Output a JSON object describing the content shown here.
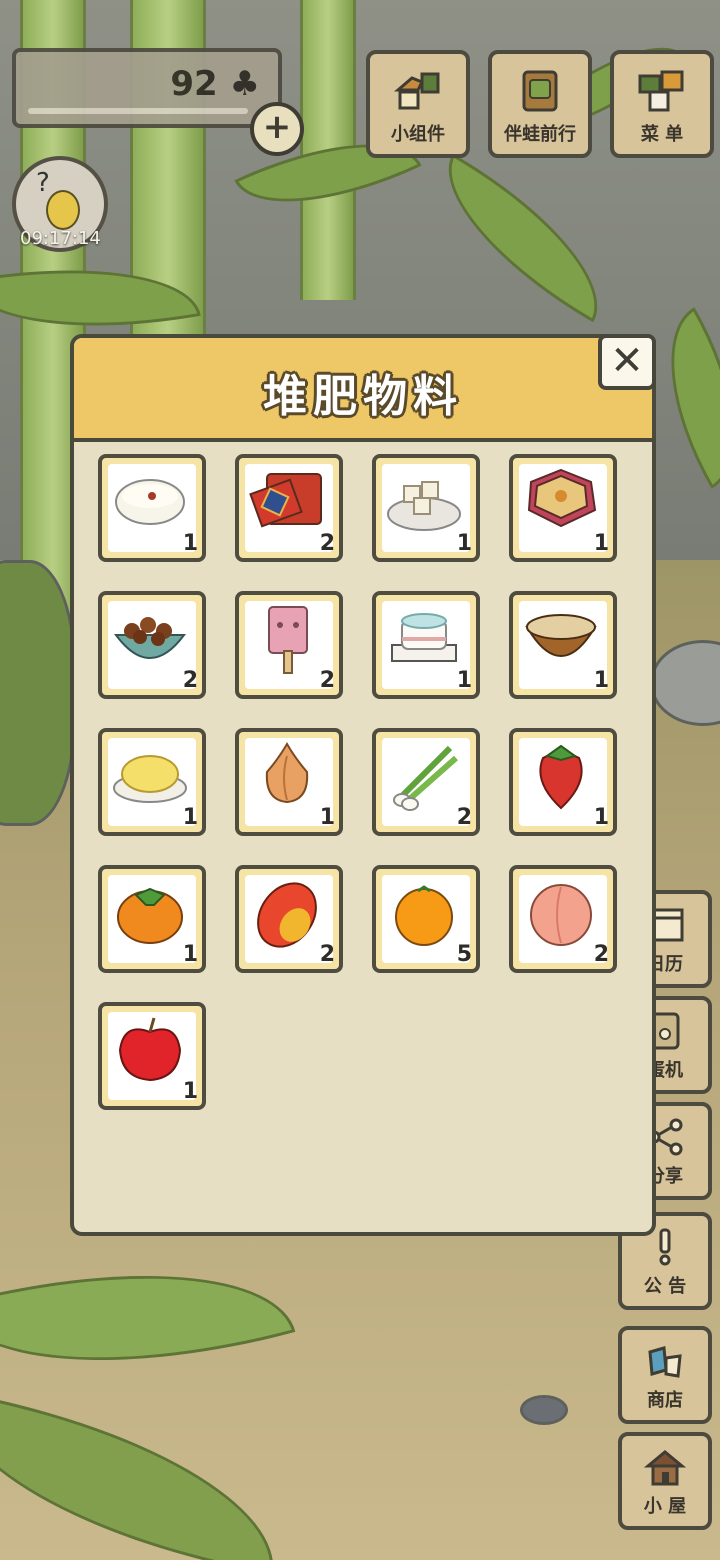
{
  "hud": {
    "clover_count": "92",
    "clover_icon": "clover-icon",
    "plus_label": "+",
    "timer": "09:17:14"
  },
  "top_buttons": [
    {
      "label": "小组件",
      "icon": "widget-icon"
    },
    {
      "label": "伴蛙前行",
      "icon": "frog-companion-icon"
    },
    {
      "label": "菜 单",
      "icon": "menu-icon"
    }
  ],
  "side_buttons": [
    {
      "label": "日历",
      "icon": "calendar-icon"
    },
    {
      "label": "蛋机",
      "icon": "gacha-machine-icon"
    },
    {
      "label": "分享",
      "icon": "share-icon"
    },
    {
      "label": "公 告",
      "icon": "notice-icon"
    },
    {
      "label": "商店",
      "icon": "shop-icon"
    },
    {
      "label": "小 屋",
      "icon": "house-icon"
    }
  ],
  "modal": {
    "title": "堆肥物料",
    "close_label": "✕",
    "items": [
      {
        "name": "rice-porridge",
        "count": "1"
      },
      {
        "name": "lucky-gift-box",
        "count": "2"
      },
      {
        "name": "tofu-plate",
        "count": "1"
      },
      {
        "name": "bento-box",
        "count": "1"
      },
      {
        "name": "chestnut-bowl",
        "count": "2"
      },
      {
        "name": "pink-popsicle",
        "count": "2"
      },
      {
        "name": "sponge-cake",
        "count": "1"
      },
      {
        "name": "miso-soup",
        "count": "1"
      },
      {
        "name": "scrambled-egg",
        "count": "1"
      },
      {
        "name": "onion",
        "count": "1"
      },
      {
        "name": "green-onion",
        "count": "2"
      },
      {
        "name": "strawberry",
        "count": "1"
      },
      {
        "name": "persimmon",
        "count": "1"
      },
      {
        "name": "mango",
        "count": "2"
      },
      {
        "name": "mandarin-orange",
        "count": "5"
      },
      {
        "name": "peach",
        "count": "2"
      },
      {
        "name": "apple",
        "count": "1"
      }
    ]
  },
  "colors": {
    "header": "#eec766",
    "panel": "#e7dfc3",
    "slot_border": "#f6e3a6",
    "dark_outline": "#4a4a3c"
  }
}
